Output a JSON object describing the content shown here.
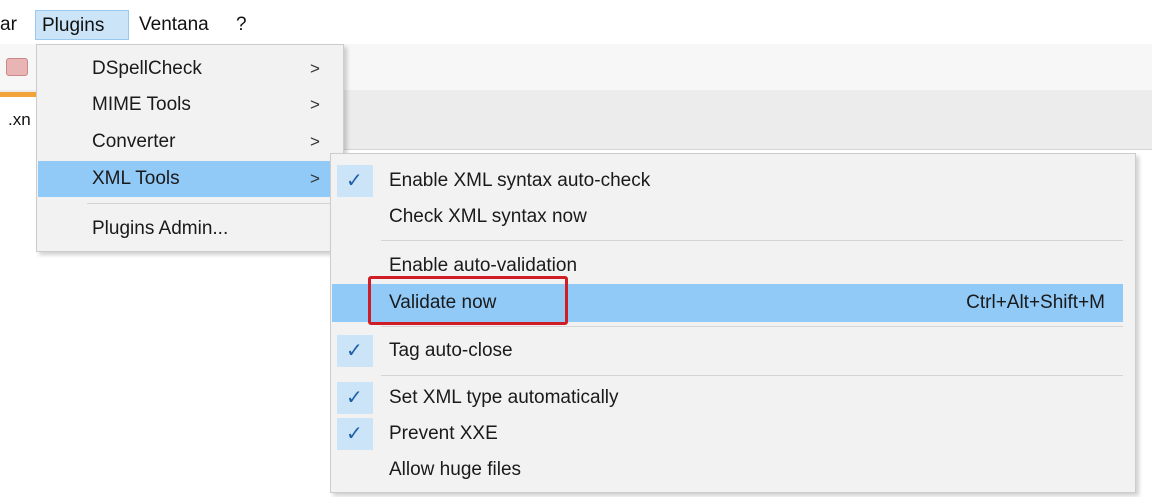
{
  "menubar": {
    "items": [
      {
        "label": "ar"
      },
      {
        "label": "Plugins"
      },
      {
        "label": "Ventana"
      },
      {
        "label": "?"
      }
    ]
  },
  "background": {
    "tab_label": ".xn"
  },
  "plugins_menu": {
    "items": [
      {
        "label": "DSpellCheck",
        "arrow": ">"
      },
      {
        "label": "MIME Tools",
        "arrow": ">"
      },
      {
        "label": "Converter",
        "arrow": ">"
      },
      {
        "label": "XML Tools",
        "arrow": ">"
      },
      {
        "label": "Plugins Admin..."
      }
    ]
  },
  "xml_tools_menu": {
    "check_glyph": "✓",
    "items": [
      {
        "label": "Enable XML syntax auto-check",
        "checked": true
      },
      {
        "label": "Check XML syntax now",
        "checked": false
      },
      {
        "label": "Enable auto-validation",
        "checked": false
      },
      {
        "label": "Validate now",
        "shortcut": "Ctrl+Alt+Shift+M",
        "checked": false
      },
      {
        "label": "Tag auto-close",
        "checked": true
      },
      {
        "label": "Set XML type automatically",
        "checked": true
      },
      {
        "label": "Prevent XXE",
        "checked": true
      },
      {
        "label": "Allow huge files",
        "checked": false
      }
    ]
  },
  "colors": {
    "highlight": "#91c9f7",
    "check_gutter": "#cce4f7",
    "annotation_red": "#d01c24"
  }
}
